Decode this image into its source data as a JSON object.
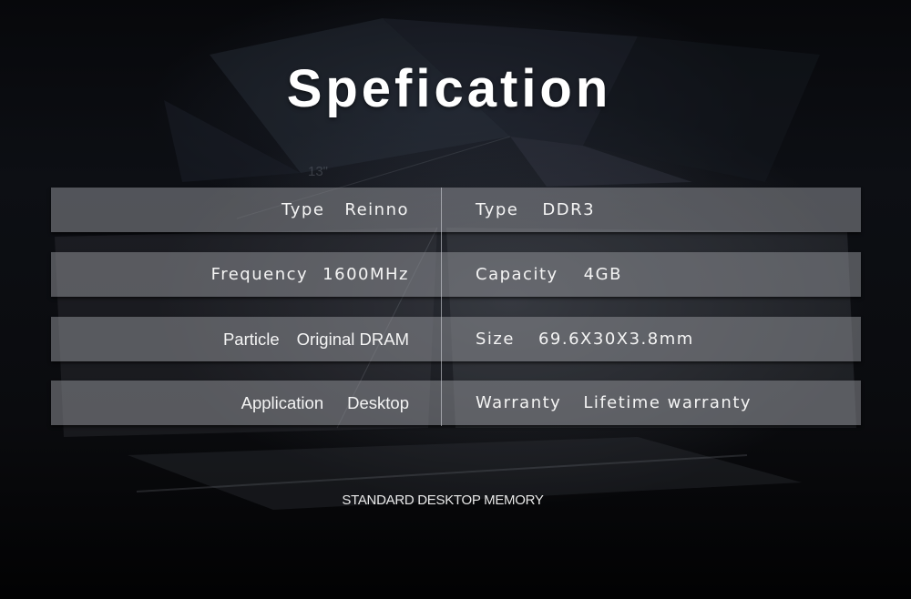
{
  "title": "Spefication",
  "background_label": "13\"",
  "specs": [
    {
      "left": {
        "label": "Type",
        "value": "Reinno"
      },
      "right": {
        "label": "Type",
        "value": "DDR3"
      }
    },
    {
      "left": {
        "label": "Frequency",
        "value": "1600MHz"
      },
      "right": {
        "label": "Capacity",
        "value": "4GB"
      }
    },
    {
      "left": {
        "label": "Particle",
        "value": "Original DRAM"
      },
      "right": {
        "label": "Size",
        "value": "69.6X30X3.8mm"
      }
    },
    {
      "left": {
        "label": "Application",
        "value": "Desktop"
      },
      "right": {
        "label": "Warranty",
        "value": "Lifetime warranty"
      }
    }
  ],
  "subtitle": "STANDARD DESKTOP MEMORY"
}
